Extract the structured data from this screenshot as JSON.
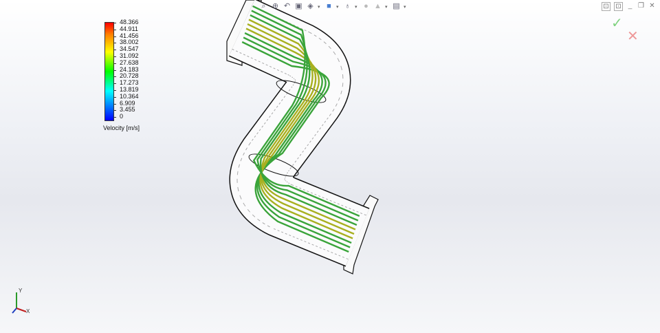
{
  "legend": {
    "ticks": [
      "48.366",
      "44.911",
      "41.456",
      "38.002",
      "34.547",
      "31.092",
      "27.638",
      "24.183",
      "20.728",
      "17.273",
      "13.819",
      "10.364",
      "6.909",
      "3.455",
      "0"
    ],
    "label": "Velocity [m/s]",
    "min": 0,
    "max": 48.366
  },
  "toolbar": {
    "icons": [
      "zoom-to-fit-icon",
      "zoom-to-area-icon",
      "previous-view-icon",
      "section-view-icon",
      "view-orientation-icon",
      "display-style-icon",
      "hide-show-items-icon",
      "edit-appearance-icon",
      "apply-scene-icon",
      "view-settings-icon"
    ]
  },
  "window": {
    "ok_symbol": "✓",
    "cancel_symbol": "✕"
  },
  "triad": {
    "y": "Y",
    "x": "X"
  },
  "colors": {
    "streamline_green": "#3aa43a",
    "streamline_yellow": "#a8b020",
    "streamline_red": "#c06020"
  }
}
